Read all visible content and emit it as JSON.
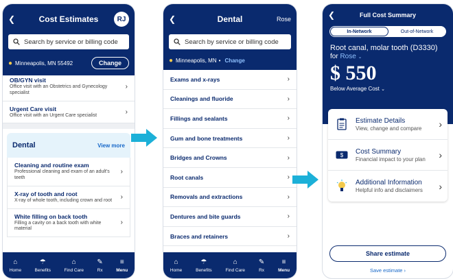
{
  "screen1": {
    "title": "Cost Estimates",
    "avatar": "RJ",
    "search_placeholder": "Search by service or billing code",
    "location": "Minneapolis, MN 55492",
    "change": "Change",
    "top_items": [
      {
        "title": "OB/GYN visit",
        "desc": "Office visit with an Obstetrics and Gynecology specialist"
      },
      {
        "title": "Urgent Care visit",
        "desc": "Office visit with an Urgent Care specialist"
      }
    ],
    "dental_title": "Dental",
    "view_more": "View more",
    "dental_items": [
      {
        "title": "Cleaning and routine exam",
        "desc": "Professional cleaning and exam of an adult's teeth"
      },
      {
        "title": "X-ray of tooth and root",
        "desc": "X-ray of whole tooth, including crown and root"
      },
      {
        "title": "White filling on back tooth",
        "desc": "Filling a cavity on a back tooth with white material"
      }
    ]
  },
  "screen2": {
    "title": "Dental",
    "member": "Rose",
    "search_placeholder": "Search by service or billing code",
    "location": "Minneapolis, MN",
    "separator": "•",
    "change": "Change",
    "categories": [
      "Exams and x-rays",
      "Cleanings and fluoride",
      "Fillings and sealants",
      "Gum and bone treatments",
      "Bridges and Crowns",
      "Root canals",
      "Removals and extractions",
      "Dentures and bite guards",
      "Braces and retainers"
    ]
  },
  "tabs": [
    "Home",
    "Benefits",
    "Find Care",
    "Rx",
    "Menu"
  ],
  "screen3": {
    "title": "Full Cost Summary",
    "seg_in": "In-Network",
    "seg_out": "Out-of-Network",
    "procedure": "Root canal, molar tooth (D3330)",
    "for_label": "for",
    "member": "Rose",
    "price": "$ 550",
    "cost_note": "Below Average Cost",
    "options": [
      {
        "title": "Estimate Details",
        "desc": "View, change and compare"
      },
      {
        "title": "Cost Summary",
        "desc": "Financial impact to your plan"
      },
      {
        "title": "Additional Information",
        "desc": "Helpful info and disclaimers"
      }
    ],
    "share": "Share estimate",
    "save": "Save estimate ›"
  },
  "colors": {
    "navy": "#0a2a6e",
    "accent": "#1cb0d8",
    "link": "#1667c8",
    "pin": "#f2c94c"
  }
}
